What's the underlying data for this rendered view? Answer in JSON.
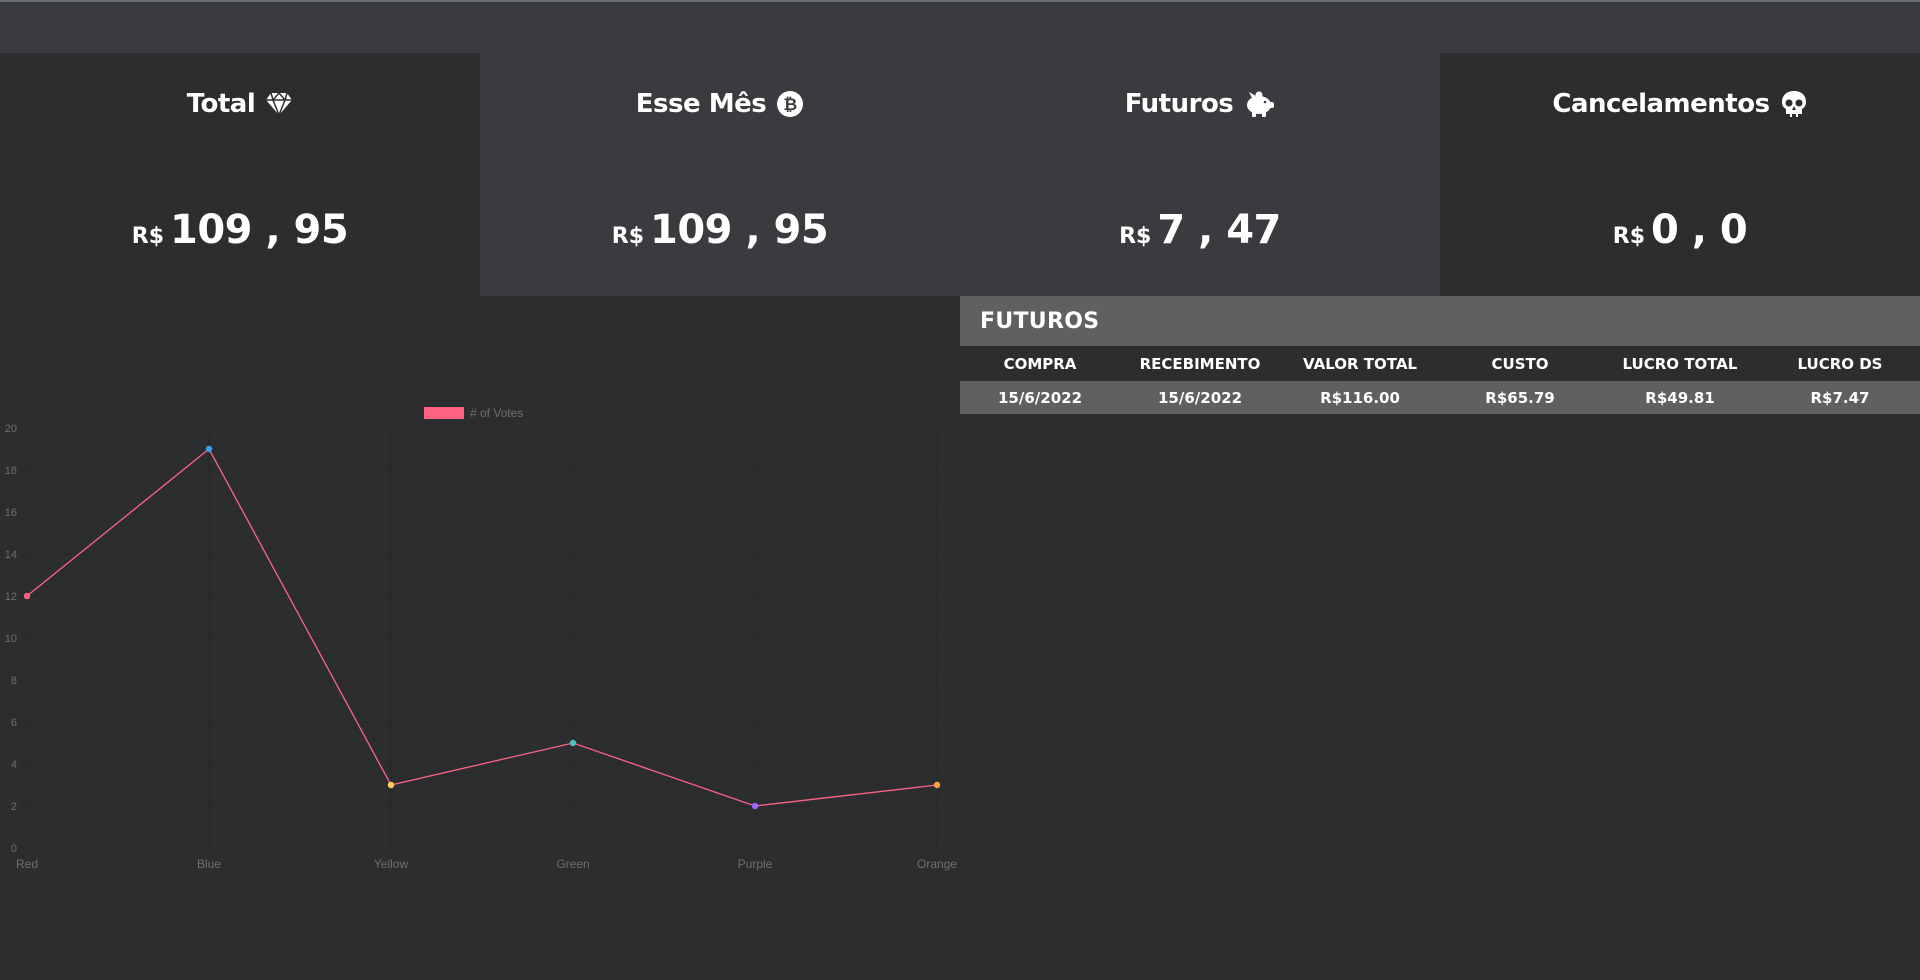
{
  "cards": [
    {
      "title": "Total",
      "icon": "gem-icon",
      "currency": "R$",
      "value": "109 , 95"
    },
    {
      "title": "Esse Mês",
      "icon": "bitcoin-icon",
      "currency": "R$",
      "value": "109 , 95"
    },
    {
      "title": "Futuros",
      "icon": "piggy-bank-icon",
      "currency": "R$",
      "value": "7 , 47"
    },
    {
      "title": "Cancelamentos",
      "icon": "skull-icon",
      "currency": "R$",
      "value": "0 , 0"
    }
  ],
  "futuros": {
    "title": "FUTUROS",
    "columns": [
      "COMPRA",
      "RECEBIMENTO",
      "VALOR TOTAL",
      "CUSTO",
      "LUCRO TOTAL",
      "LUCRO DS"
    ],
    "rows": [
      [
        "15/6/2022",
        "15/6/2022",
        "R$116.00",
        "R$65.79",
        "R$49.81",
        "R$7.47"
      ]
    ]
  },
  "chart_data": {
    "type": "line",
    "categories": [
      "Red",
      "Blue",
      "Yellow",
      "Green",
      "Purple",
      "Orange"
    ],
    "series": [
      {
        "name": "# of Votes",
        "values": [
          12,
          19,
          3,
          5,
          2,
          3
        ],
        "color": "#ff6384"
      }
    ],
    "point_colors": [
      "#ff6384",
      "#36a2eb",
      "#ffce56",
      "#4bc0c0",
      "#9966ff",
      "#ff9f40"
    ],
    "ylim": [
      0,
      20
    ],
    "yticks": [
      0,
      2,
      4,
      6,
      8,
      10,
      12,
      14,
      16,
      18,
      20
    ],
    "legend_position": "top-center",
    "grid": true
  }
}
